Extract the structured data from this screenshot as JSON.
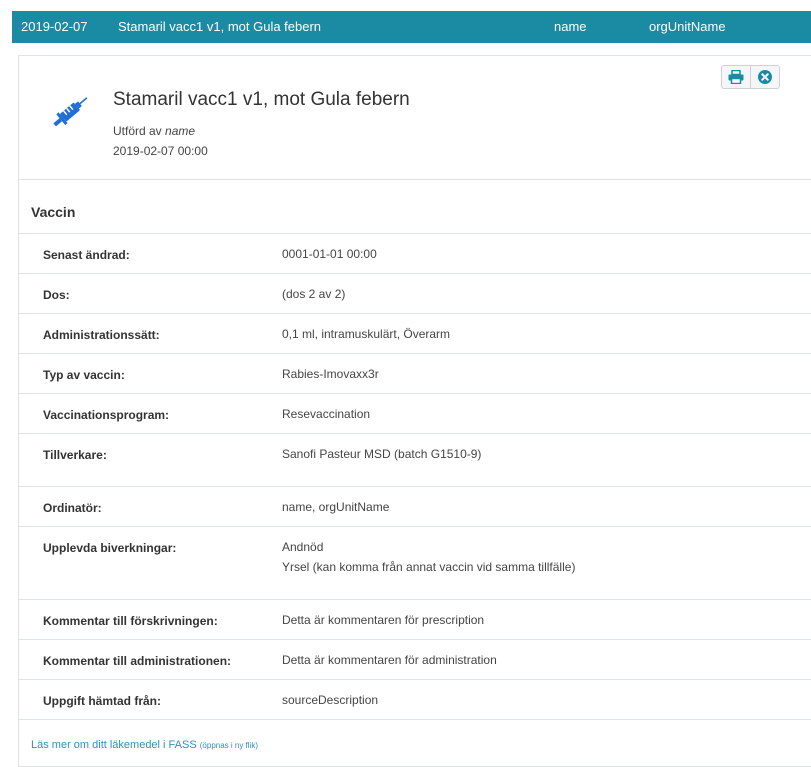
{
  "topbar": {
    "date": "2019-02-07",
    "title": "Stamaril vacc1 v1, mot Gula febern",
    "name": "name",
    "org": "orgUnitName"
  },
  "header": {
    "icon": "syringe-icon",
    "title": "Stamaril vacc1 v1, mot Gula febern",
    "performed_by_label": "Utförd av",
    "performed_by_value": "name",
    "datetime": "2019-02-07 00:00",
    "buttons": [
      "print-icon",
      "close-icon"
    ]
  },
  "section": {
    "title": "Vaccin"
  },
  "rows": [
    {
      "label": "Senast ändrad:",
      "values": [
        "0001-01-01 00:00"
      ]
    },
    {
      "label": "Dos:",
      "values": [
        "(dos 2 av 2)"
      ]
    },
    {
      "label": "Administrationssätt:",
      "values": [
        "0,1 ml, intramuskulärt, Överarm"
      ]
    },
    {
      "label": "Typ av vaccin:",
      "values": [
        "Rabies-Imovaxx3r"
      ]
    },
    {
      "label": "Vaccinationsprogram:",
      "values": [
        "Resevaccination"
      ]
    },
    {
      "label": "Tillverkare:",
      "values": [
        "Sanofi Pasteur MSD (batch G1510-9)"
      ]
    },
    {
      "label": "Ordinatör:",
      "values": [
        "name, orgUnitName"
      ]
    },
    {
      "label": "Upplevda biverkningar:",
      "values": [
        "Andnöd",
        "Yrsel (kan komma från annat vaccin vid samma tillfälle)"
      ]
    },
    {
      "label": "Kommentar till förskrivningen:",
      "values": [
        "Detta är kommentaren för prescription"
      ]
    },
    {
      "label": "Kommentar till administrationen:",
      "values": [
        "Detta är kommentaren för administration"
      ]
    },
    {
      "label": "Uppgift hämtad från:",
      "values": [
        "sourceDescription"
      ]
    }
  ],
  "footer": {
    "link_text": "Läs mer om ditt läkemedel i FASS",
    "link_note": "(öppnas i ny flik)"
  },
  "colors": {
    "topbar": "#1b8ba3",
    "icon_blue": "#1f6fd6",
    "link": "#2d8fbf"
  }
}
